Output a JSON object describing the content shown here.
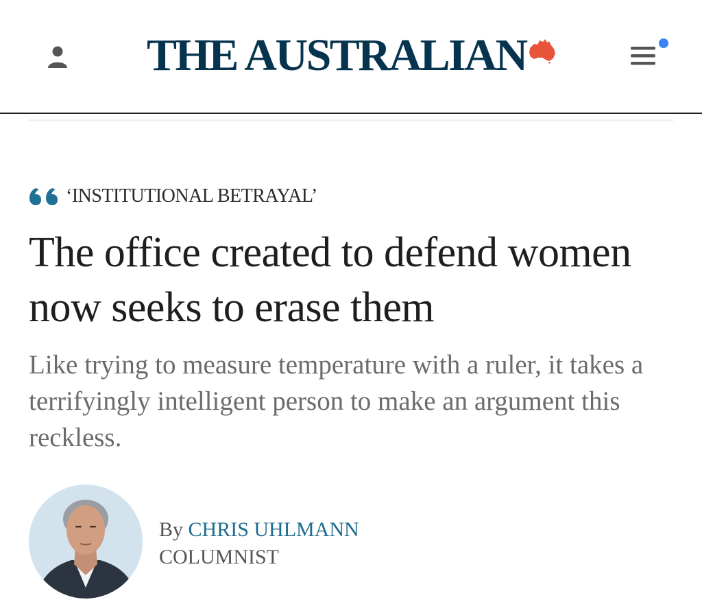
{
  "header": {
    "account_icon": "person-icon",
    "masthead": "THE AUSTRALIAN",
    "masthead_emblem_icon": "australia-map-icon",
    "menu_icon": "hamburger-menu-icon",
    "notification_dot": true
  },
  "colors": {
    "brand_navy": "#06344f",
    "map_red": "#e8543a",
    "kicker_quote": "#1f7195",
    "author_link": "#1d6c8f",
    "notification_blue": "#3b82f6"
  },
  "article": {
    "kicker_icon": "quote-icon",
    "kicker": "‘INSTITUTIONAL BETRAYAL’",
    "headline": "The office created to defend women now seeks to erase them",
    "standfirst": "Like trying to measure temperature with a ruler, it takes a terrifyingly intelligent person to make an argument this reckless.",
    "byline": {
      "prefix": "By",
      "author": "CHRIS UHLMANN",
      "role": "COLUMNIST"
    }
  }
}
